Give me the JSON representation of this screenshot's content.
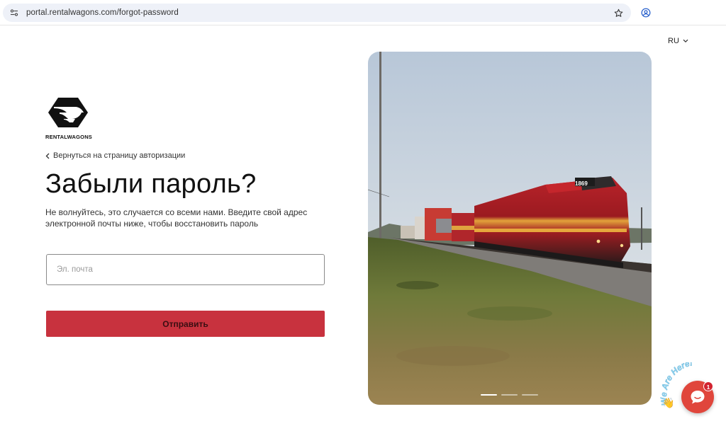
{
  "browser": {
    "url": "portal.rentalwagons.com/forgot-password"
  },
  "lang": {
    "selected": "RU"
  },
  "logo": {
    "name": "RENTALWAGONS"
  },
  "back_link": {
    "label": "Вернуться на страницу авторизации"
  },
  "form": {
    "title": "Забыли пароль?",
    "subtitle": "Не волнуйтесь, это случается со всеми нами. Введите свой адрес электронной почты ниже, чтобы восстановить пароль",
    "email_placeholder": "Эл. почта",
    "email_value": "",
    "submit_label": "Отправить"
  },
  "hero": {
    "locomotive_number": "1869",
    "carousel_active_index": 0,
    "carousel_count": 3
  },
  "chat": {
    "tagline": "We Are Here!",
    "unread_count": "1"
  },
  "colors": {
    "accent": "#c8323e",
    "chat": "#e0463c"
  }
}
